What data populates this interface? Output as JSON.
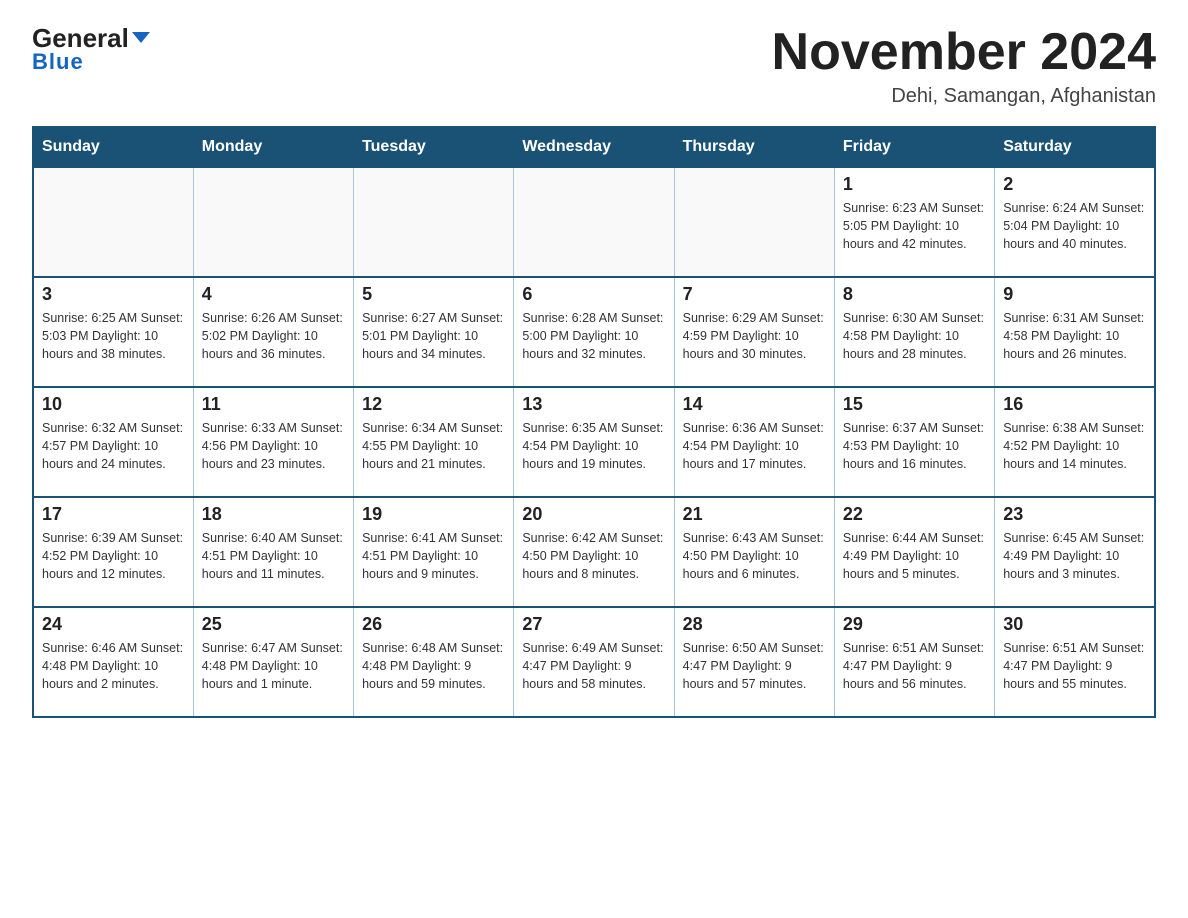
{
  "header": {
    "logo_general": "General",
    "logo_blue": "Blue",
    "month_title": "November 2024",
    "location": "Dehi, Samangan, Afghanistan"
  },
  "weekdays": [
    "Sunday",
    "Monday",
    "Tuesday",
    "Wednesday",
    "Thursday",
    "Friday",
    "Saturday"
  ],
  "rows": [
    [
      {
        "day": "",
        "info": ""
      },
      {
        "day": "",
        "info": ""
      },
      {
        "day": "",
        "info": ""
      },
      {
        "day": "",
        "info": ""
      },
      {
        "day": "",
        "info": ""
      },
      {
        "day": "1",
        "info": "Sunrise: 6:23 AM\nSunset: 5:05 PM\nDaylight: 10 hours and 42 minutes."
      },
      {
        "day": "2",
        "info": "Sunrise: 6:24 AM\nSunset: 5:04 PM\nDaylight: 10 hours and 40 minutes."
      }
    ],
    [
      {
        "day": "3",
        "info": "Sunrise: 6:25 AM\nSunset: 5:03 PM\nDaylight: 10 hours and 38 minutes."
      },
      {
        "day": "4",
        "info": "Sunrise: 6:26 AM\nSunset: 5:02 PM\nDaylight: 10 hours and 36 minutes."
      },
      {
        "day": "5",
        "info": "Sunrise: 6:27 AM\nSunset: 5:01 PM\nDaylight: 10 hours and 34 minutes."
      },
      {
        "day": "6",
        "info": "Sunrise: 6:28 AM\nSunset: 5:00 PM\nDaylight: 10 hours and 32 minutes."
      },
      {
        "day": "7",
        "info": "Sunrise: 6:29 AM\nSunset: 4:59 PM\nDaylight: 10 hours and 30 minutes."
      },
      {
        "day": "8",
        "info": "Sunrise: 6:30 AM\nSunset: 4:58 PM\nDaylight: 10 hours and 28 minutes."
      },
      {
        "day": "9",
        "info": "Sunrise: 6:31 AM\nSunset: 4:58 PM\nDaylight: 10 hours and 26 minutes."
      }
    ],
    [
      {
        "day": "10",
        "info": "Sunrise: 6:32 AM\nSunset: 4:57 PM\nDaylight: 10 hours and 24 minutes."
      },
      {
        "day": "11",
        "info": "Sunrise: 6:33 AM\nSunset: 4:56 PM\nDaylight: 10 hours and 23 minutes."
      },
      {
        "day": "12",
        "info": "Sunrise: 6:34 AM\nSunset: 4:55 PM\nDaylight: 10 hours and 21 minutes."
      },
      {
        "day": "13",
        "info": "Sunrise: 6:35 AM\nSunset: 4:54 PM\nDaylight: 10 hours and 19 minutes."
      },
      {
        "day": "14",
        "info": "Sunrise: 6:36 AM\nSunset: 4:54 PM\nDaylight: 10 hours and 17 minutes."
      },
      {
        "day": "15",
        "info": "Sunrise: 6:37 AM\nSunset: 4:53 PM\nDaylight: 10 hours and 16 minutes."
      },
      {
        "day": "16",
        "info": "Sunrise: 6:38 AM\nSunset: 4:52 PM\nDaylight: 10 hours and 14 minutes."
      }
    ],
    [
      {
        "day": "17",
        "info": "Sunrise: 6:39 AM\nSunset: 4:52 PM\nDaylight: 10 hours and 12 minutes."
      },
      {
        "day": "18",
        "info": "Sunrise: 6:40 AM\nSunset: 4:51 PM\nDaylight: 10 hours and 11 minutes."
      },
      {
        "day": "19",
        "info": "Sunrise: 6:41 AM\nSunset: 4:51 PM\nDaylight: 10 hours and 9 minutes."
      },
      {
        "day": "20",
        "info": "Sunrise: 6:42 AM\nSunset: 4:50 PM\nDaylight: 10 hours and 8 minutes."
      },
      {
        "day": "21",
        "info": "Sunrise: 6:43 AM\nSunset: 4:50 PM\nDaylight: 10 hours and 6 minutes."
      },
      {
        "day": "22",
        "info": "Sunrise: 6:44 AM\nSunset: 4:49 PM\nDaylight: 10 hours and 5 minutes."
      },
      {
        "day": "23",
        "info": "Sunrise: 6:45 AM\nSunset: 4:49 PM\nDaylight: 10 hours and 3 minutes."
      }
    ],
    [
      {
        "day": "24",
        "info": "Sunrise: 6:46 AM\nSunset: 4:48 PM\nDaylight: 10 hours and 2 minutes."
      },
      {
        "day": "25",
        "info": "Sunrise: 6:47 AM\nSunset: 4:48 PM\nDaylight: 10 hours and 1 minute."
      },
      {
        "day": "26",
        "info": "Sunrise: 6:48 AM\nSunset: 4:48 PM\nDaylight: 9 hours and 59 minutes."
      },
      {
        "day": "27",
        "info": "Sunrise: 6:49 AM\nSunset: 4:47 PM\nDaylight: 9 hours and 58 minutes."
      },
      {
        "day": "28",
        "info": "Sunrise: 6:50 AM\nSunset: 4:47 PM\nDaylight: 9 hours and 57 minutes."
      },
      {
        "day": "29",
        "info": "Sunrise: 6:51 AM\nSunset: 4:47 PM\nDaylight: 9 hours and 56 minutes."
      },
      {
        "day": "30",
        "info": "Sunrise: 6:51 AM\nSunset: 4:47 PM\nDaylight: 9 hours and 55 minutes."
      }
    ]
  ]
}
